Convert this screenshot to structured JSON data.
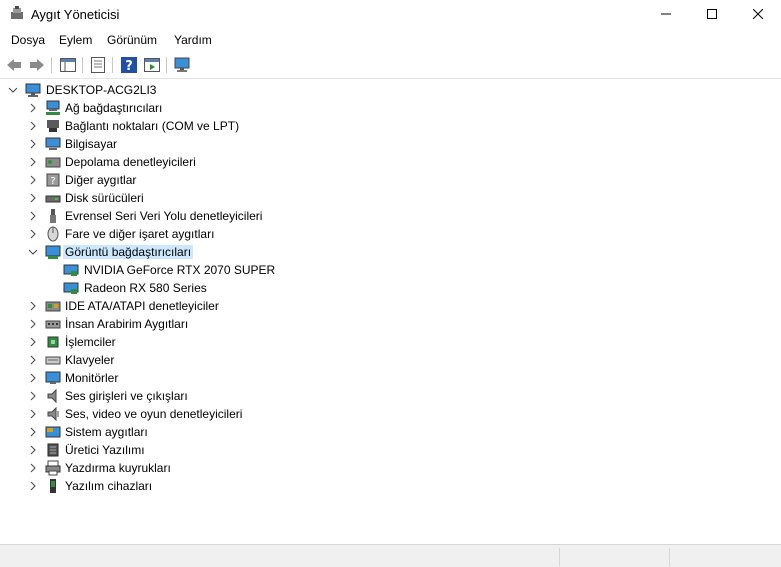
{
  "window": {
    "title": "Aygıt Yöneticisi"
  },
  "menu": [
    "Dosya",
    "Eylem",
    "Görünüm",
    "Yardım"
  ],
  "tree": {
    "root": "DESKTOP-ACG2LI3",
    "categories": [
      {
        "label": "Ağ bağdaştırıcıları",
        "icon": "network-adapter-icon"
      },
      {
        "label": "Bağlantı noktaları (COM ve LPT)",
        "icon": "port-icon"
      },
      {
        "label": "Bilgisayar",
        "icon": "computer-icon"
      },
      {
        "label": "Depolama denetleyicileri",
        "icon": "storage-controller-icon"
      },
      {
        "label": "Diğer aygıtlar",
        "icon": "unknown-device-icon"
      },
      {
        "label": "Disk sürücüleri",
        "icon": "disk-drive-icon"
      },
      {
        "label": "Evrensel Seri Veri Yolu denetleyicileri",
        "icon": "usb-icon"
      },
      {
        "label": "Fare ve diğer işaret aygıtları",
        "icon": "mouse-icon"
      },
      {
        "label": "Görüntü bağdaştırıcıları",
        "icon": "display-adapter-icon",
        "expanded": true,
        "selected": true,
        "children": [
          "NVIDIA GeForce RTX 2070 SUPER",
          "Radeon RX 580 Series"
        ]
      },
      {
        "label": "IDE ATA/ATAPI denetleyiciler",
        "icon": "ide-controller-icon"
      },
      {
        "label": "İnsan Arabirim Aygıtları",
        "icon": "hid-icon"
      },
      {
        "label": "İşlemciler",
        "icon": "processor-icon"
      },
      {
        "label": "Klavyeler",
        "icon": "keyboard-icon"
      },
      {
        "label": "Monitörler",
        "icon": "monitor-icon"
      },
      {
        "label": "Ses girişleri ve çıkışları",
        "icon": "audio-io-icon"
      },
      {
        "label": "Ses, video ve oyun denetleyicileri",
        "icon": "sound-controller-icon"
      },
      {
        "label": "Sistem aygıtları",
        "icon": "system-device-icon"
      },
      {
        "label": "Üretici Yazılımı",
        "icon": "firmware-icon"
      },
      {
        "label": "Yazdırma kuyrukları",
        "icon": "print-queue-icon"
      },
      {
        "label": "Yazılım cihazları",
        "icon": "software-device-icon"
      }
    ]
  }
}
